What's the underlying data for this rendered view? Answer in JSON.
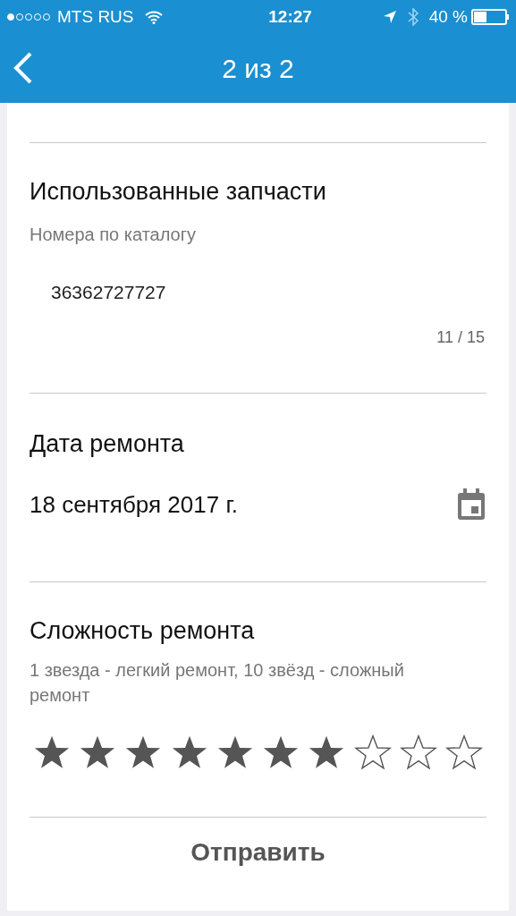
{
  "status_bar": {
    "carrier": "MTS RUS",
    "time": "12:27",
    "battery": "40 %"
  },
  "nav": {
    "title": "2 из 2"
  },
  "parts": {
    "title": "Использованные запчасти",
    "hint": "Номера по каталогу",
    "value": "36362727727",
    "counter": "11 / 15"
  },
  "date": {
    "title": "Дата ремонта",
    "value": "18 сентября 2017 г."
  },
  "difficulty": {
    "title": "Сложность ремонта",
    "hint": "1 звезда - легкий ремонт, 10 звёзд - сложный ремонт",
    "stars": 7
  },
  "submit": {
    "label": "Отправить"
  }
}
